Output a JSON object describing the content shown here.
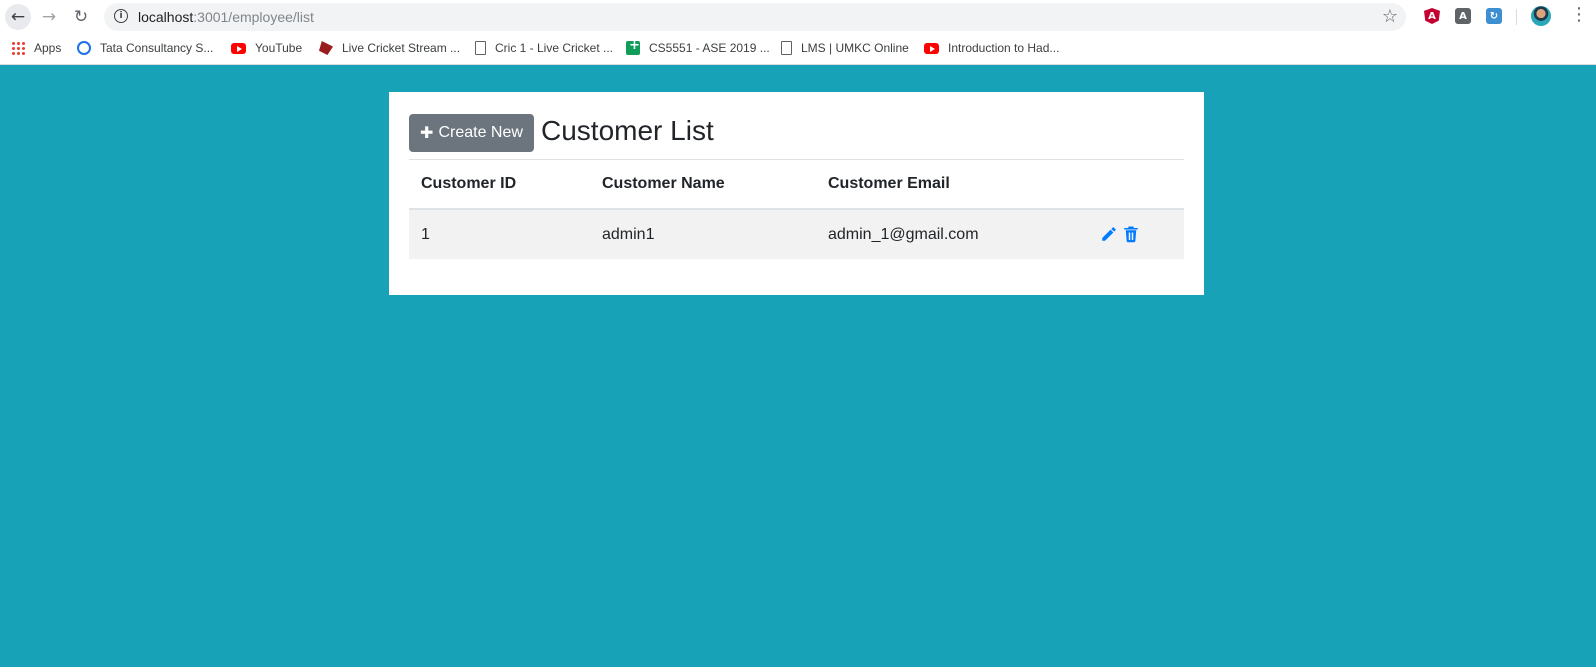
{
  "browser": {
    "url_host": "localhost",
    "url_path": ":3001/employee/list",
    "bookmarks": [
      {
        "label": "Apps",
        "icon": "apps-grid-icon"
      },
      {
        "label": "Tata Consultancy S...",
        "icon": "tcs-icon"
      },
      {
        "label": "YouTube",
        "icon": "youtube-icon"
      },
      {
        "label": "Live Cricket Stream ...",
        "icon": "cricket-icon"
      },
      {
        "label": "Cric 1 - Live Cricket ...",
        "icon": "page-icon"
      },
      {
        "label": "CS5551 - ASE 2019 ...",
        "icon": "sheets-icon"
      },
      {
        "label": "LMS | UMKC Online",
        "icon": "page-icon"
      },
      {
        "label": "Introduction to Had...",
        "icon": "youtube-icon"
      }
    ]
  },
  "colors": {
    "page_background": "#17a2b8",
    "button_secondary": "#6c757d",
    "action_icon": "#007bff"
  },
  "header": {
    "create_button_label": "Create New",
    "title": "Customer List"
  },
  "table": {
    "columns": [
      "Customer ID",
      "Customer Name",
      "Customer Email",
      ""
    ],
    "rows": [
      {
        "id": "1",
        "name": "admin1",
        "email": "admin_1@gmail.com",
        "actions": [
          "edit-pencil-icon",
          "delete-trash-icon"
        ]
      }
    ]
  }
}
